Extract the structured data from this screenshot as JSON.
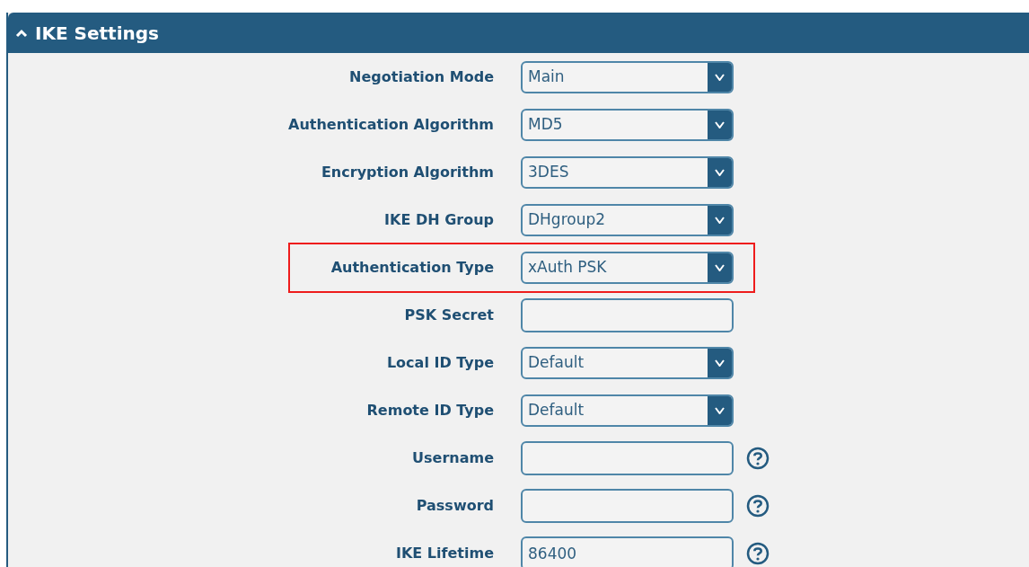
{
  "panel": {
    "title": "IKE Settings",
    "expanded": true
  },
  "rows": [
    {
      "label": "Negotiation Mode",
      "kind": "select",
      "value": "Main",
      "help": false,
      "highlighted": false
    },
    {
      "label": "Authentication Algorithm",
      "kind": "select",
      "value": "MD5",
      "help": false,
      "highlighted": false
    },
    {
      "label": "Encryption Algorithm",
      "kind": "select",
      "value": "3DES",
      "help": false,
      "highlighted": false
    },
    {
      "label": "IKE DH Group",
      "kind": "select",
      "value": "DHgroup2",
      "help": false,
      "highlighted": false
    },
    {
      "label": "Authentication Type",
      "kind": "select",
      "value": "xAuth PSK",
      "help": false,
      "highlighted": true
    },
    {
      "label": "PSK Secret",
      "kind": "input",
      "help": false,
      "highlighted": false
    },
    {
      "label": "Local ID Type",
      "kind": "select",
      "value": "Default",
      "help": false,
      "highlighted": false
    },
    {
      "label": "Remote ID Type",
      "kind": "select",
      "value": "Default",
      "help": false,
      "highlighted": false
    },
    {
      "label": "Username",
      "kind": "input",
      "help": true,
      "highlighted": false
    },
    {
      "label": "Password",
      "kind": "input",
      "help": true,
      "highlighted": false
    },
    {
      "label": "IKE Lifetime",
      "kind": "input",
      "value": "86400",
      "help": true,
      "highlighted": false
    }
  ]
}
